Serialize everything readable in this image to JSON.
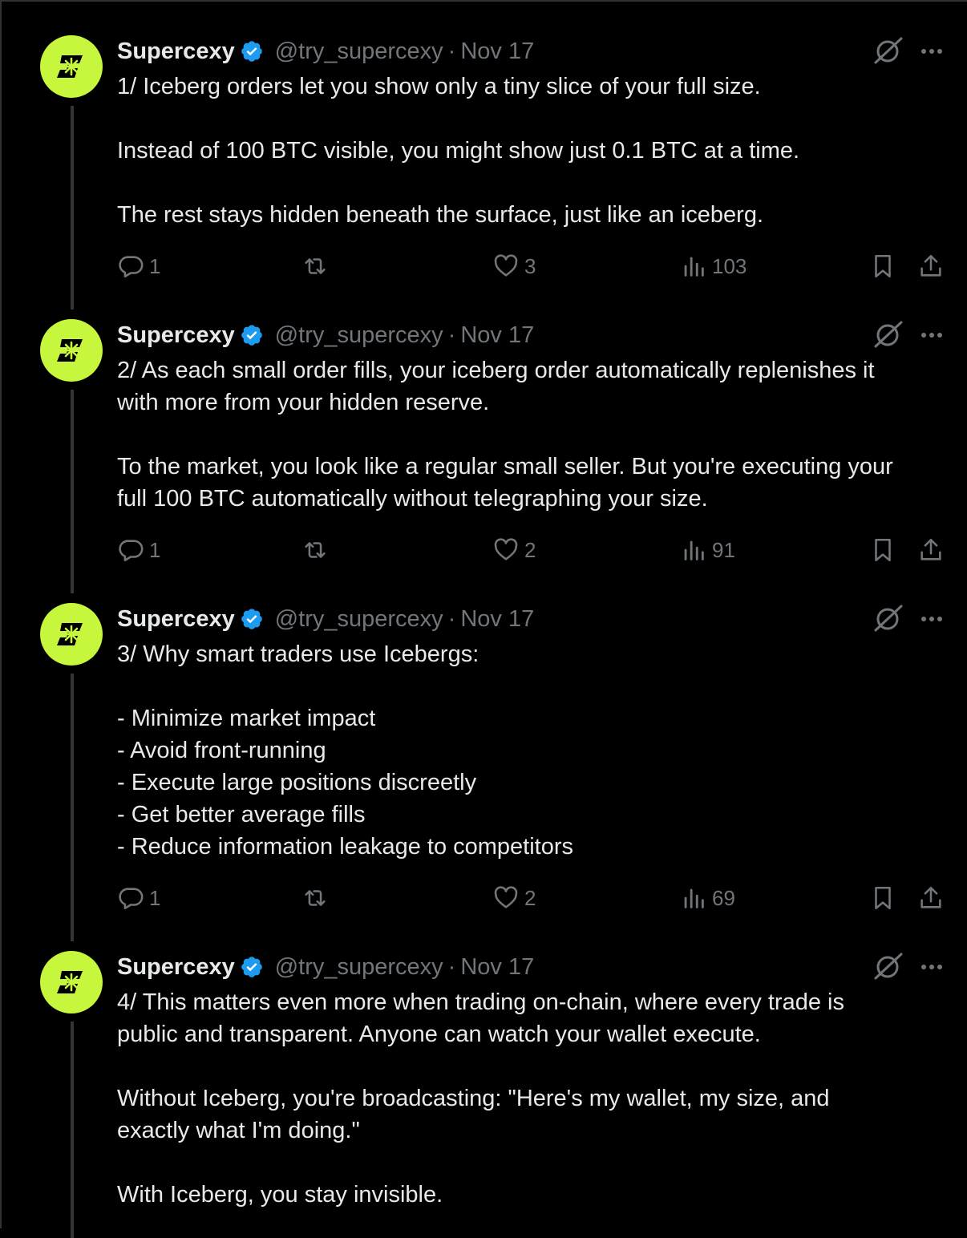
{
  "author": {
    "name": "Supercexy",
    "handle": "@try_supercexy",
    "separator": "·",
    "avatar_color": "#c6f73c",
    "verified_color": "#1d9bf0"
  },
  "tweets": [
    {
      "date": "Nov 17",
      "text": "1/ Iceberg orders let you show only a tiny slice of your full size.\n\nInstead of 100 BTC visible, you might show just 0.1 BTC at a time.\n\nThe rest stays hidden beneath the surface, just like an iceberg.",
      "replies": "1",
      "reposts": "",
      "likes": "3",
      "views": "103"
    },
    {
      "date": "Nov 17",
      "text": "2/ As each small order fills, your iceberg order automatically replenishes it\nwith more from your hidden reserve.\n\nTo the market, you look like a regular small seller. But you're executing your\nfull 100 BTC automatically without telegraphing your size.",
      "replies": "1",
      "reposts": "",
      "likes": "2",
      "views": "91"
    },
    {
      "date": "Nov 17",
      "text": "3/ Why smart traders use Icebergs:\n\n- Minimize market impact\n- Avoid front-running\n- Execute large positions discreetly\n- Get better average fills\n- Reduce information leakage to competitors",
      "replies": "1",
      "reposts": "",
      "likes": "2",
      "views": "69"
    },
    {
      "date": "Nov 17",
      "text": "4/ This matters even more when trading on-chain, where every trade is\npublic and transparent. Anyone can watch your wallet execute.\n\nWithout Iceberg, you're broadcasting: \"Here's my wallet, my size, and\nexactly what I'm doing.\"\n\nWith Iceberg, you stay invisible.",
      "replies": "",
      "reposts": "",
      "likes": "",
      "views": ""
    }
  ],
  "icons": {
    "reply": "reply-icon",
    "repost": "repost-icon",
    "like": "heart-icon",
    "views": "views-chart-icon",
    "bookmark": "bookmark-icon",
    "share": "share-icon",
    "grok": "grok-icon",
    "more": "more-icon",
    "verified": "verified-badge-icon"
  }
}
